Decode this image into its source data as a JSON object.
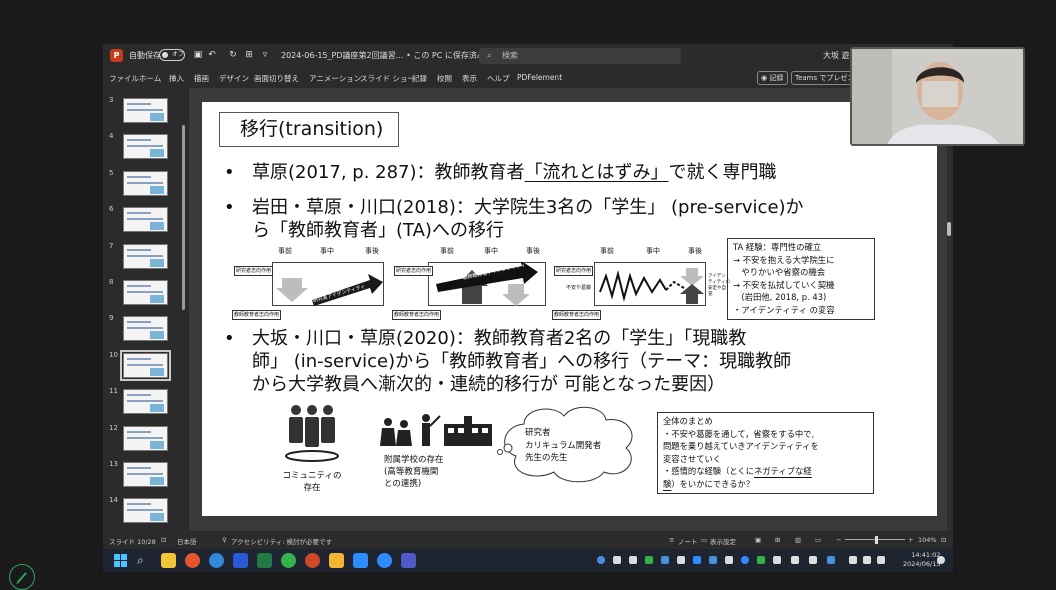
{
  "titlebar": {
    "autosave_label": "自動保存",
    "autosave_state": "オフ",
    "filename": "2024-06-15_PD議座第2回議習… • この PC に保存済み ∨",
    "search_placeholder": "検索",
    "user_name": "大坂 遊"
  },
  "menu": {
    "items": [
      "ファイル",
      "ホーム",
      "挿入",
      "描画",
      "デザイン",
      "画面切り替え",
      "アニメーション",
      "スライド ショー",
      "記録",
      "校閲",
      "表示",
      "ヘルプ",
      "PDFelement"
    ],
    "record_button": "◉ 記録",
    "teams_button": "Teams でプレゼン"
  },
  "thumbnails": [
    {
      "num": "3"
    },
    {
      "num": "4"
    },
    {
      "num": "5"
    },
    {
      "num": "6"
    },
    {
      "num": "7"
    },
    {
      "num": "8"
    },
    {
      "num": "9"
    },
    {
      "num": "10",
      "selected": true
    },
    {
      "num": "11"
    },
    {
      "num": "12"
    },
    {
      "num": "13"
    },
    {
      "num": "14"
    }
  ],
  "slide": {
    "title": "移行(transition)",
    "bullet1": {
      "pre": "草原(2017, p. 287)：教師教育者",
      "underlined": "「流れとはずみ」",
      "post": "で就く専門職"
    },
    "bullet2": {
      "line1": "岩田・草原・川口(2018)：大学院生3名の「学生」 (pre-service)か",
      "line2": "ら「教師教育者」(TA)への移行"
    },
    "diagram": {
      "phase_before": "事前",
      "phase_during": "事中",
      "phase_after": "事後",
      "research_action": "研究者志向作用",
      "teacher_action": "教師教育者志向作用",
      "identity_1": "研究者アイデンティティ",
      "identity_2": "教師教育者アイデンティティ",
      "unstable": "不安や葛藤",
      "stable_note": "アイデンティティの安定や自覚"
    },
    "ta_box": {
      "lines": [
        "TA 経験：専門性の確立",
        "→ 不安を抱える大学院生に",
        "　やりかいや省察の機会",
        "→ 不安を払拭していく契機",
        "　(岩田他, 2018, p. 43)",
        "・アイデンティティ の変容"
      ]
    },
    "bullet3": {
      "line1": "大坂・川口・草原(2020)：教師教育者2名の「学生」「現職教",
      "line2": "師」 (in-service)から「教師教育者」への移行（テーマ：現職教師",
      "line3": "から大学教員へ漸次的・連続的移行が 可能となった要因）"
    },
    "community_caption": "コミュニティの\n存在",
    "school_caption": "附属学校の存在\n(高等教育機関\nとの連携)",
    "cloud_lines": [
      "研究者",
      "カリキュラム開発者",
      "先生の先生"
    ],
    "summary": {
      "lines": [
        "全体のまとめ",
        "・不安や葛藤を通して，省察をする中で,",
        "問題を乗り越えていきアイデンティティを",
        "変容させていく",
        "・感情的な経験（とくに"
      ],
      "underlined": "ネガティブな経",
      "tail_underlined": "験",
      "tail": "）をいかにできるか？"
    }
  },
  "status": {
    "slide_pos": "スライド 10/28",
    "language": "日本語",
    "accessibility": "アクセシビリティ: 検討が必要です",
    "notes": "ノート",
    "display_settings": "表示設定",
    "zoom": "104%"
  },
  "clock": {
    "time": "14:41:02",
    "date": "2024/06/15"
  },
  "colors": {
    "accent": "#c43e1c",
    "taskbar": "#1e2530"
  }
}
